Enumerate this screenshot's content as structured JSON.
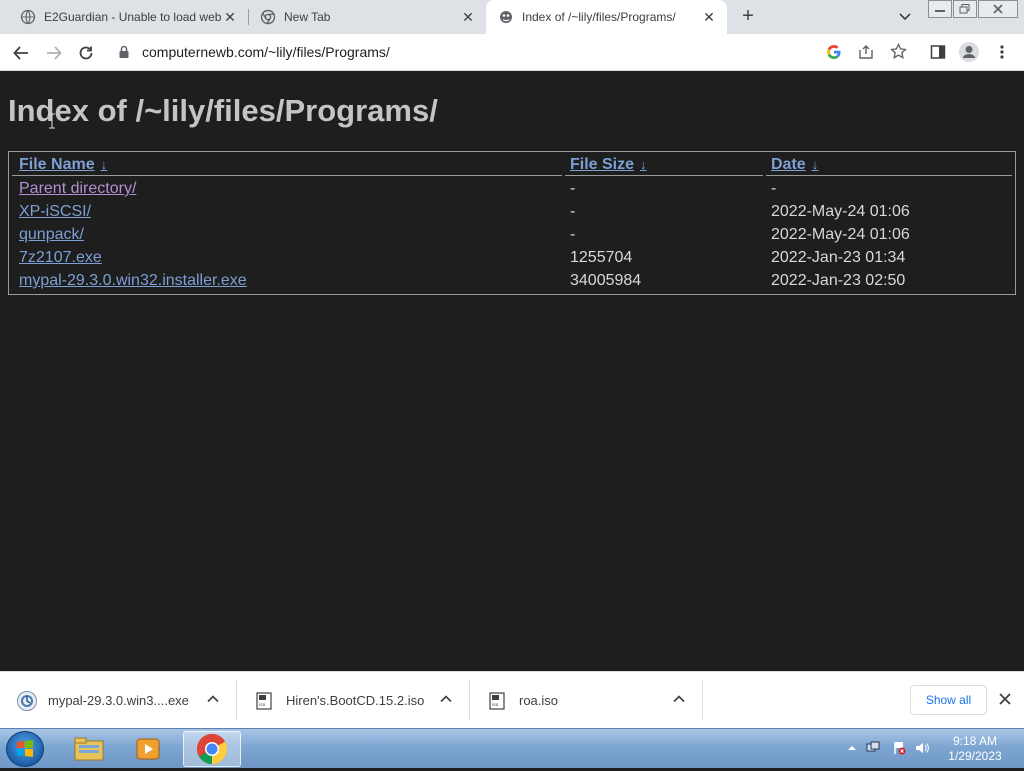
{
  "browser": {
    "tabs": [
      {
        "title": "E2Guardian - Unable to load web",
        "icon": "globe-icon"
      },
      {
        "title": "New Tab",
        "icon": "chrome-icon"
      },
      {
        "title": "Index of /~lily/files/Programs/",
        "icon": "site-icon"
      }
    ],
    "url": "computernewb.com/~lily/files/Programs/"
  },
  "page": {
    "heading": "Index of /~lily/files/Programs/",
    "columns": {
      "name": "File Name",
      "size": "File Size",
      "date": "Date",
      "sort_arrow": "↓"
    },
    "rows": [
      {
        "name": "Parent directory/",
        "size": "-",
        "date": "-"
      },
      {
        "name": "XP-iSCSI/",
        "size": "-",
        "date": "2022-May-24 01:06"
      },
      {
        "name": "qunpack/",
        "size": "-",
        "date": "2022-May-24 01:06"
      },
      {
        "name": "7z2107.exe",
        "size": "1255704",
        "date": "2022-Jan-23 01:34"
      },
      {
        "name": "mypal-29.3.0.win32.installer.exe",
        "size": "34005984",
        "date": "2022-Jan-23 02:50"
      }
    ]
  },
  "downloads": {
    "items": [
      {
        "name": "mypal-29.3.0.win3....exe",
        "icon": "installer-icon"
      },
      {
        "name": "Hiren's.BootCD.15.2.iso",
        "icon": "disc-image-icon"
      },
      {
        "name": "roa.iso",
        "icon": "disc-image-icon"
      }
    ],
    "show_all": "Show all"
  },
  "taskbar": {
    "time": "9:18 AM",
    "date": "1/29/2023"
  }
}
